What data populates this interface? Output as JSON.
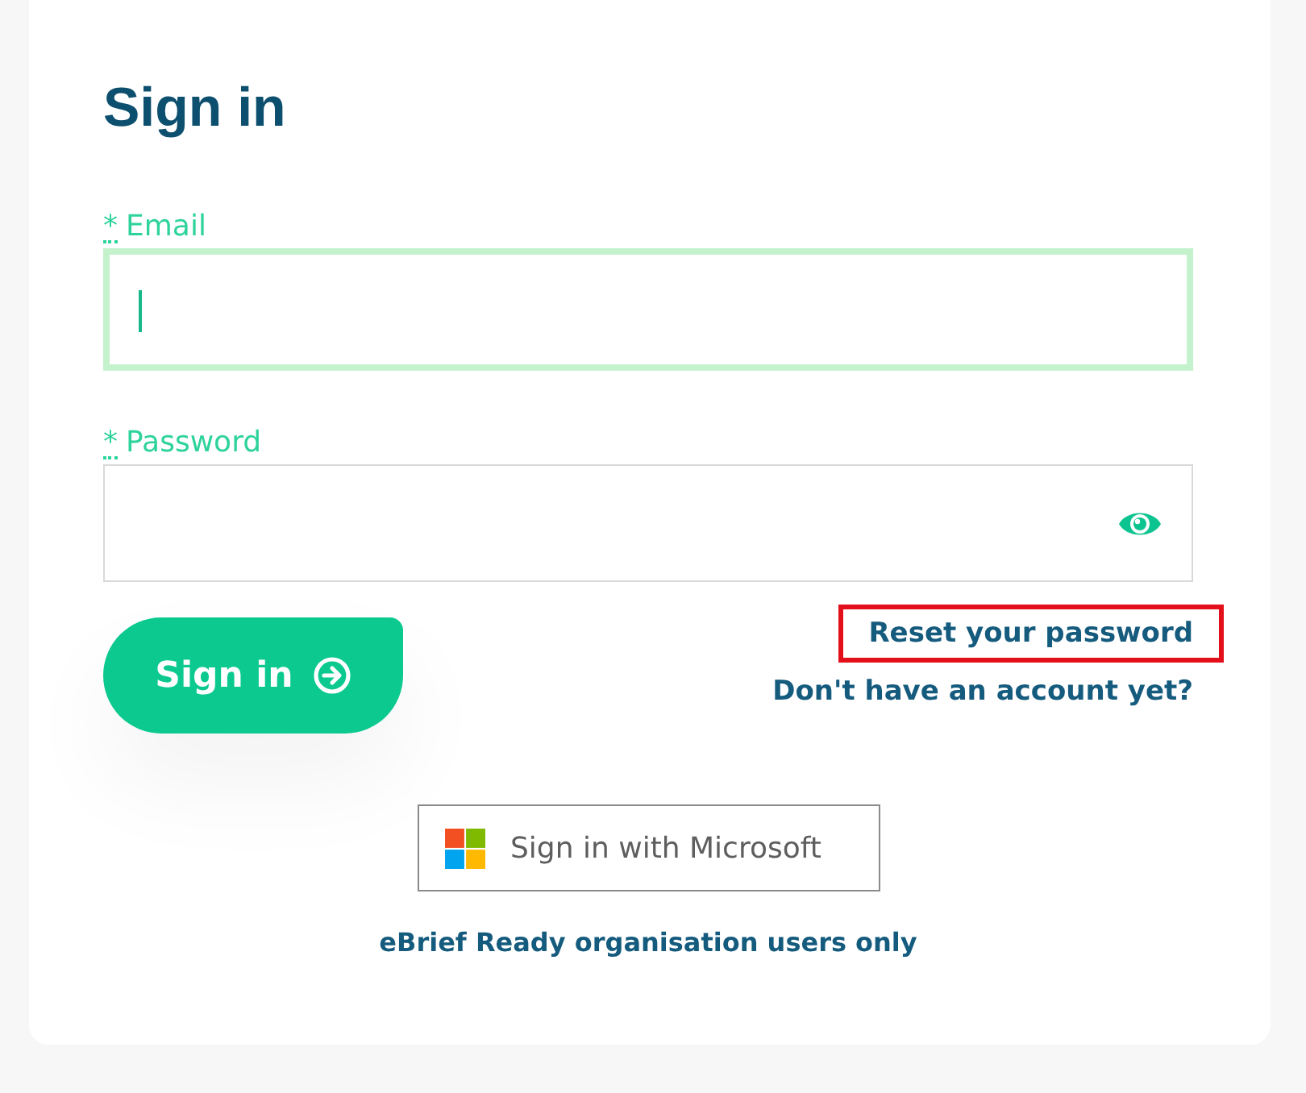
{
  "title": "Sign in",
  "fields": [
    {
      "required_mark": "*",
      "label": "Email",
      "focused": true,
      "reveal_toggle": false
    },
    {
      "required_mark": "*",
      "label": "Password",
      "focused": false,
      "reveal_toggle": true
    }
  ],
  "submit": {
    "label": "Sign in"
  },
  "links": [
    {
      "label": "Reset your password",
      "highlighted": true
    },
    {
      "label": "Don't have an account yet?",
      "highlighted": false
    }
  ],
  "microsoft_button": {
    "label": "Sign in with Microsoft"
  },
  "note": "eBrief Ready organisation users only"
}
